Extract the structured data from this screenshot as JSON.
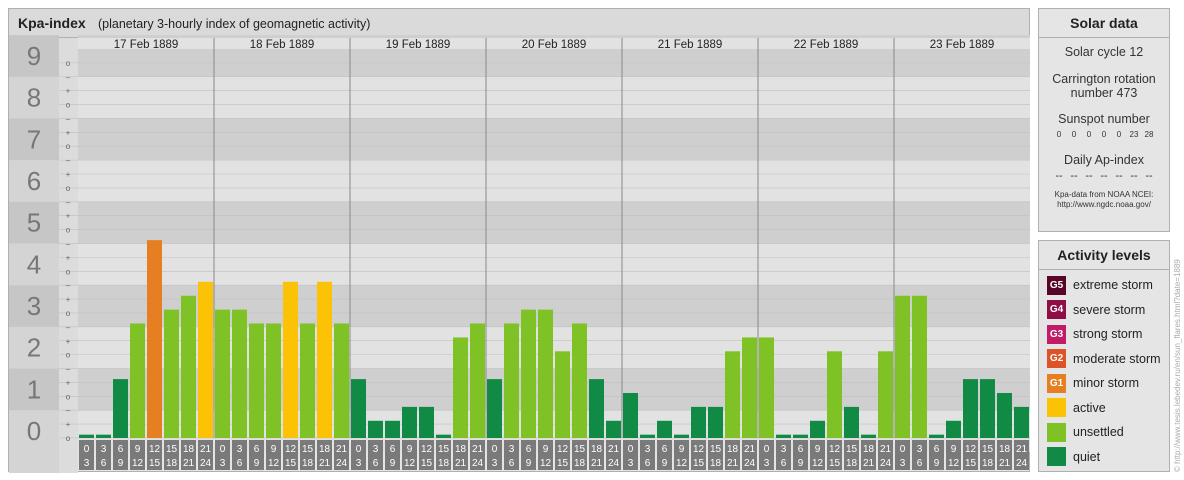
{
  "header": {
    "title": "Kpa-index",
    "subtitle": "(planetary 3-hourly index of geomagnetic activity)"
  },
  "chart_data": {
    "type": "bar",
    "title": "Kpa-index",
    "subtitle": "(planetary 3-hourly index of geomagnetic activity)",
    "ylim": [
      0,
      9
    ],
    "y_ticks": [
      "0",
      "1",
      "2",
      "3",
      "4",
      "5",
      "6",
      "7",
      "8",
      "9"
    ],
    "sub_ticks": [
      "o",
      "+",
      "–"
    ],
    "days": [
      "17 Feb 1889",
      "18 Feb 1889",
      "19 Feb 1889",
      "20 Feb 1889",
      "21 Feb 1889",
      "22 Feb 1889",
      "23 Feb 1889"
    ],
    "interval_start_hours": [
      "0",
      "3",
      "6",
      "9",
      "12",
      "15",
      "18",
      "21"
    ],
    "interval_end_hours": [
      "3",
      "6",
      "9",
      "12",
      "15",
      "18",
      "21",
      "24"
    ],
    "values": [
      [
        0,
        0,
        1.333,
        2.667,
        4.667,
        3,
        3.333,
        3.667
      ],
      [
        3,
        3,
        2.667,
        2.667,
        3.667,
        2.667,
        3.667,
        2.667
      ],
      [
        1.333,
        0.333,
        0.333,
        0.667,
        0.667,
        0,
        2.333,
        2.667
      ],
      [
        1.333,
        2.667,
        3,
        3,
        2,
        2.667,
        1.333,
        0.333
      ],
      [
        1,
        0,
        0.333,
        0,
        0.667,
        0.667,
        2,
        2.333
      ],
      [
        2.333,
        0,
        0,
        0.333,
        2,
        0.667,
        0,
        2
      ],
      [
        3.333,
        3.333,
        0,
        0.333,
        1.333,
        1.333,
        1,
        0.667
      ]
    ],
    "colors": {
      "quiet": "#118a45",
      "unsettled": "#7ec225",
      "active": "#fcc206",
      "minor_storm": "#e67e22",
      "moderate_storm": "#dd5226",
      "strong_storm": "#c01d66",
      "severe_storm": "#8f0e46",
      "extreme_storm": "#5a0429"
    }
  },
  "solar": {
    "title": "Solar data",
    "cycle": "Solar cycle 12",
    "rotation_line1": "Carrington rotation",
    "rotation_line2": "number 473",
    "sunspot_label": "Sunspot number",
    "sunspot_values": [
      "0",
      "0",
      "0",
      "0",
      "0",
      "23",
      "28"
    ],
    "ap_label": "Daily Ap-index",
    "ap_values": [
      "--",
      "--",
      "--",
      "--",
      "--",
      "--",
      "--"
    ],
    "source_line1": "Kpa-data from NOAA NCEI:",
    "source_line2": "http://www.ngdc.noaa.gov/"
  },
  "activity": {
    "title": "Activity levels",
    "levels": [
      {
        "badge": "G5",
        "label": "extreme storm",
        "color": "#5a0429"
      },
      {
        "badge": "G4",
        "label": "severe storm",
        "color": "#8f0e46"
      },
      {
        "badge": "G3",
        "label": "strong storm",
        "color": "#c01d66"
      },
      {
        "badge": "G2",
        "label": "moderate storm",
        "color": "#dd5226"
      },
      {
        "badge": "G1",
        "label": "minor storm",
        "color": "#e67e22"
      },
      {
        "badge": "",
        "label": "active",
        "color": "#fcc206"
      },
      {
        "badge": "",
        "label": "unsettled",
        "color": "#7ec225"
      },
      {
        "badge": "",
        "label": "quiet",
        "color": "#118a45"
      }
    ]
  },
  "credit": "© http://www.tesis.lebedev.ru/en/sun_flares.html?date=1889"
}
